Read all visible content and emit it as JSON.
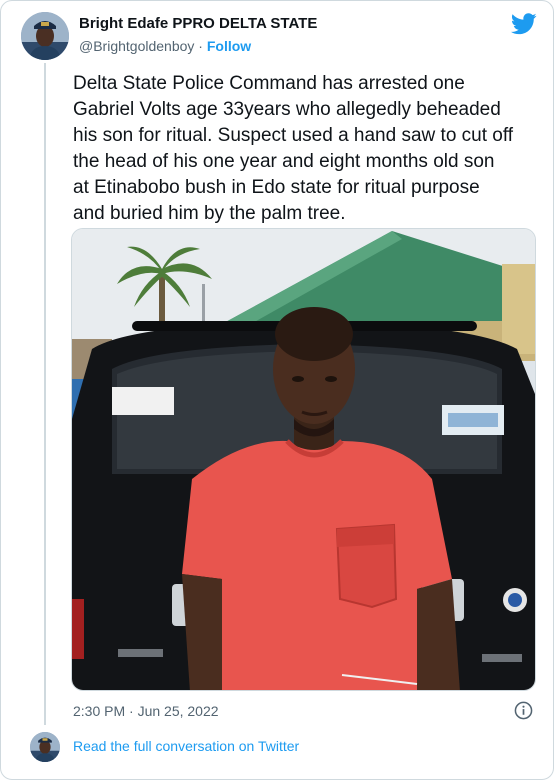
{
  "author": {
    "name": "Bright Edafe PPRO DELTA STATE",
    "handle": "@Brightgoldenboy",
    "separator": "·",
    "follow_label": "Follow",
    "avatar_icon": "police-avatar-icon"
  },
  "tweet": {
    "lines": [
      "Delta State Police Command has arrested one",
      "Gabriel Volts age 33years who allegedly beheaded",
      "his son for ritual. Suspect used a hand saw to cut off",
      "the head of his one year and eight months old son",
      "at Etinabobo bush in Edo state for ritual purpose",
      "and buried him by the palm tree."
    ],
    "timestamp": "2:30 PM · Jun 25, 2022"
  },
  "footer": {
    "read_more": "Read the full conversation on Twitter"
  },
  "icons": {
    "brand": "twitter-bird-icon",
    "info": "info-icon"
  },
  "colors": {
    "accent": "#1d9bf0",
    "text": "#0f1419",
    "secondary": "#536471",
    "border": "#cfd9de"
  }
}
